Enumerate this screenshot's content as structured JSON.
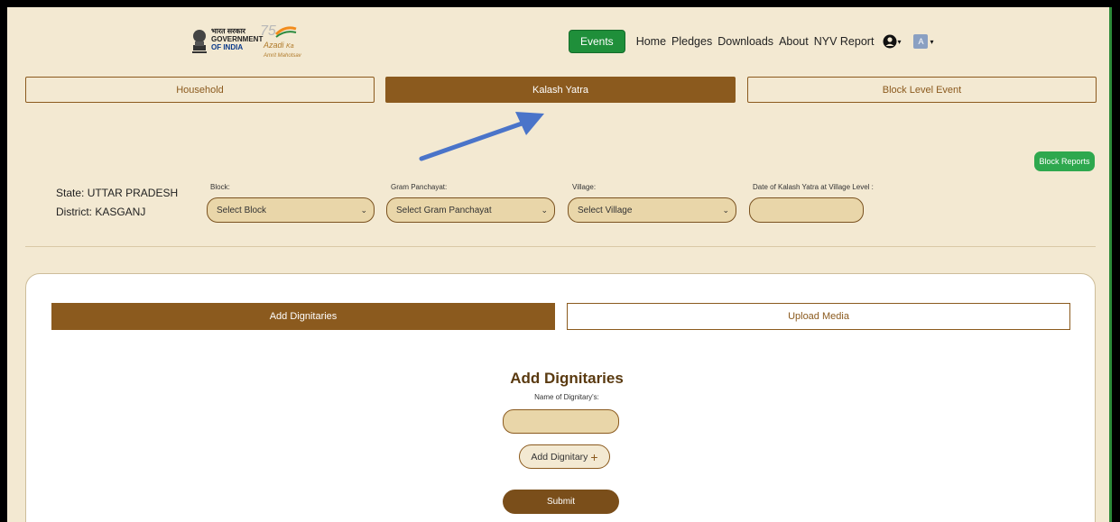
{
  "header": {
    "gov_line1": "भारत सरकार",
    "gov_line2": "GOVERNMENT",
    "gov_line3": "OF INDIA",
    "amrit_line1": "Azadi",
    "amrit_line2": "Ka",
    "amrit_line3": "Amrit Mahotsav",
    "amrit_number": "75"
  },
  "nav": {
    "events": "Events",
    "links": [
      "Home",
      "Pledges",
      "Downloads",
      "About",
      "NYV Report"
    ],
    "user_icon": "user-icon",
    "language_icon": "translate-icon",
    "caret": "▾"
  },
  "main_tabs": [
    "Household",
    "Kalash Yatra",
    "Block Level Event"
  ],
  "block_reports": "Block Reports",
  "location": {
    "state": "State: UTTAR PRADESH",
    "district": "District: KASGANJ"
  },
  "filters": {
    "block_label": "Block:",
    "block_value": "Select Block",
    "gp_label": "Gram Panchayat:",
    "gp_value": "Select Gram Panchayat",
    "village_label": "Village:",
    "village_value": "Select Village",
    "date_label": "Date of Kalash Yatra at Village Level :",
    "date_value": ""
  },
  "sub_tabs": [
    "Add Dignitaries",
    "Upload Media"
  ],
  "form": {
    "title": "Add Dignitaries",
    "name_label": "Name of Dignitary's:",
    "name_value": "",
    "add_button": "Add Dignitary",
    "add_icon": "+",
    "submit": "Submit"
  },
  "colors": {
    "brand_brown": "#8b5a1e",
    "background": "#f3e9d2",
    "events_green": "#1f8f3a",
    "arrow_blue": "#4a74c9"
  }
}
